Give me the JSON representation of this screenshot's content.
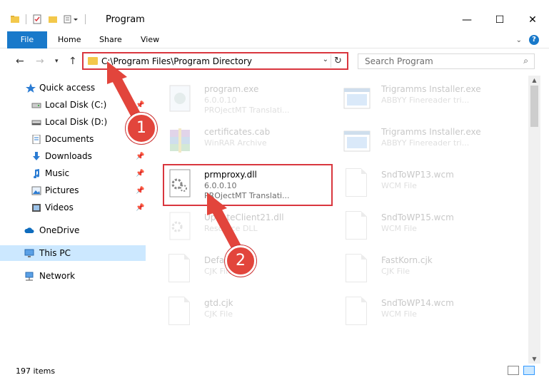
{
  "window": {
    "title": "Program",
    "controls": {
      "minimize": "—",
      "maximize": "☐",
      "close": "✕"
    }
  },
  "ribbon": {
    "tabs": [
      {
        "label": "File"
      },
      {
        "label": "Home"
      },
      {
        "label": "Share"
      },
      {
        "label": "View"
      }
    ],
    "help": "?"
  },
  "nav": {
    "address_path": "C:\\Program Files\\Program Directory",
    "search_placeholder": "Search Program"
  },
  "sidebar": {
    "items": [
      {
        "label": "Quick access",
        "icon": "star-icon",
        "pinned": false
      },
      {
        "label": "Local Disk (C:)",
        "icon": "drive-icon",
        "pinned": true
      },
      {
        "label": "Local Disk (D:)",
        "icon": "drive-icon",
        "pinned": false
      },
      {
        "label": "Documents",
        "icon": "documents-icon",
        "pinned": true
      },
      {
        "label": "Downloads",
        "icon": "downloads-icon",
        "pinned": true
      },
      {
        "label": "Music",
        "icon": "music-icon",
        "pinned": true
      },
      {
        "label": "Pictures",
        "icon": "pictures-icon",
        "pinned": true
      },
      {
        "label": "Videos",
        "icon": "videos-icon",
        "pinned": true
      },
      {
        "label": "OneDrive",
        "icon": "cloud-icon",
        "pinned": false
      },
      {
        "label": "This PC",
        "icon": "computer-icon",
        "pinned": false,
        "selected": true
      },
      {
        "label": "Network",
        "icon": "network-icon",
        "pinned": false
      }
    ]
  },
  "files": [
    {
      "name": "program.exe",
      "line1": "6.0.0.10",
      "line2": "PROjectMT Translati...",
      "icon": "exe-icon"
    },
    {
      "name": "Trigramms Installer.exe",
      "line1": "ABBYY Finereader tri...",
      "line2": "",
      "icon": "window-icon"
    },
    {
      "name": "certificates.cab",
      "line1": "WinRAR Archive",
      "line2": "",
      "icon": "archive-icon"
    },
    {
      "name": "Trigramms Installer.exe",
      "line1": "ABBYY Finereader tri...",
      "line2": "",
      "icon": "window-icon"
    },
    {
      "name": "prmproxy.dll",
      "line1": "6.0.0.10",
      "line2": "PROjectMT Translati...",
      "icon": "dll-gear-icon"
    },
    {
      "name": "SndToWP13.wcm",
      "line1": "WCM File",
      "line2": "",
      "icon": "document-icon"
    },
    {
      "name": "UpdateClient21.dll",
      "line1": "Resource DLL",
      "line2": "",
      "icon": "dll-gear-icon"
    },
    {
      "name": "SndToWP15.wcm",
      "line1": "WCM File",
      "line2": "",
      "icon": "document-icon"
    },
    {
      "name": "Default.cjk",
      "line1": "CJK File",
      "line2": "",
      "icon": "document-icon"
    },
    {
      "name": "FastKorn.cjk",
      "line1": "CJK File",
      "line2": "",
      "icon": "document-icon"
    },
    {
      "name": "gtd.cjk",
      "line1": "CJK File",
      "line2": "",
      "icon": "document-icon"
    },
    {
      "name": "SndToWP14.wcm",
      "line1": "WCM File",
      "line2": "",
      "icon": "document-icon"
    }
  ],
  "status": {
    "item_count": "197 items"
  },
  "annotations": {
    "badge1": "1",
    "badge2": "2"
  },
  "colors": {
    "accent": "#1979ca",
    "highlight": "#d9363e",
    "selected": "#cce8ff"
  }
}
